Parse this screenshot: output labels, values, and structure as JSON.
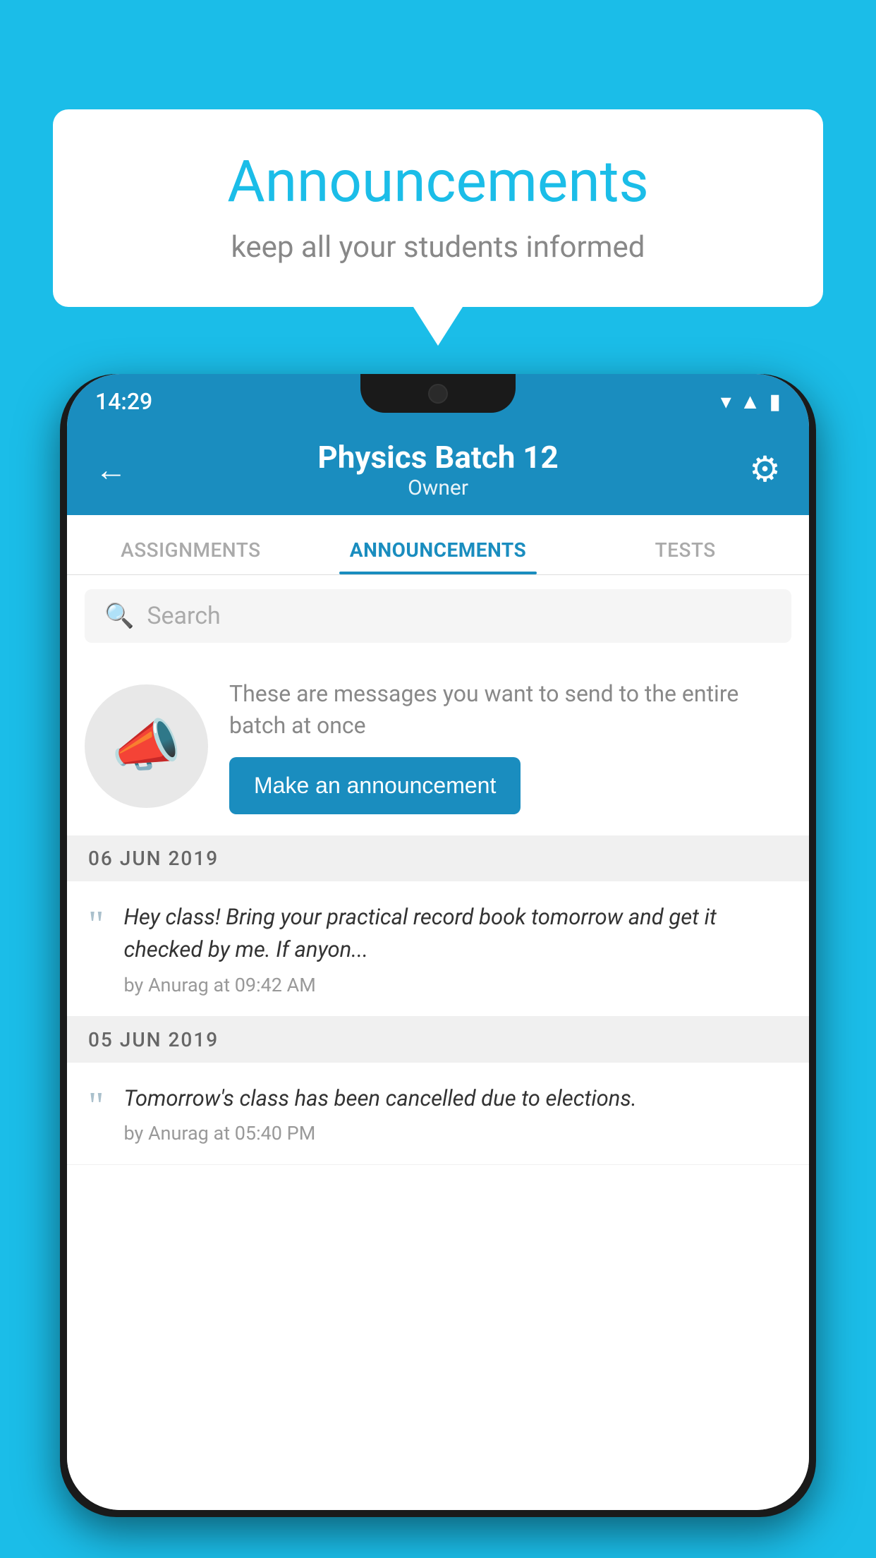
{
  "background_color": "#1BBDE8",
  "speech_bubble": {
    "title": "Announcements",
    "subtitle": "keep all your students informed"
  },
  "phone": {
    "status_bar": {
      "time": "14:29"
    },
    "header": {
      "back_label": "←",
      "title": "Physics Batch 12",
      "subtitle": "Owner",
      "settings_label": "⚙"
    },
    "tabs": [
      {
        "label": "ASSIGNMENTS",
        "active": false
      },
      {
        "label": "ANNOUNCEMENTS",
        "active": true
      },
      {
        "label": "TESTS",
        "active": false
      }
    ],
    "search": {
      "placeholder": "Search"
    },
    "promo": {
      "description": "These are messages you want to send to the entire batch at once",
      "button_label": "Make an announcement"
    },
    "announcements": [
      {
        "date": "06  JUN  2019",
        "text": "Hey class! Bring your practical record book tomorrow and get it checked by me. If anyon...",
        "meta": "by Anurag at 09:42 AM"
      },
      {
        "date": "05  JUN  2019",
        "text": "Tomorrow's class has been cancelled due to elections.",
        "meta": "by Anurag at 05:40 PM"
      }
    ]
  }
}
